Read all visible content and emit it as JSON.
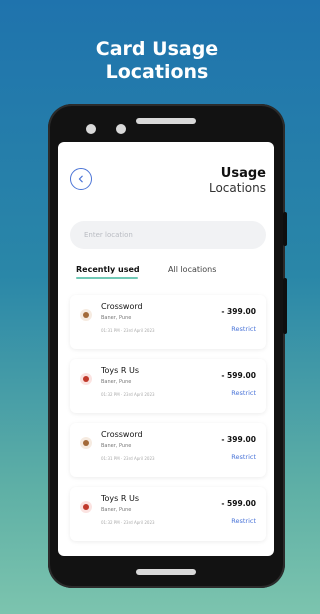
{
  "headline": {
    "line1": "Card Usage",
    "line2": "Locations"
  },
  "header": {
    "title": "Usage",
    "subtitle": "Locations"
  },
  "search": {
    "placeholder": "Enter location",
    "value": ""
  },
  "tabs": [
    {
      "label": "Recently used"
    },
    {
      "label": "All locations"
    }
  ],
  "transactions": [
    {
      "store": "Crossword",
      "location": "Baner, Pune",
      "datetime": "01:31 PM · 23rd April 2023",
      "amount": "- 399.00",
      "action": "Restrict",
      "icon": "bookstore-icon",
      "icon_color": "#a36a3a",
      "icon_bg": "#f6ebe1"
    },
    {
      "store": "Toys R Us",
      "location": "Baner, Pune",
      "datetime": "01:32 PM · 23rd April 2023",
      "amount": "- 599.00",
      "action": "Restrict",
      "icon": "toy-store-icon",
      "icon_color": "#c0392b",
      "icon_bg": "#fbe3e1"
    },
    {
      "store": "Crossword",
      "location": "Baner, Pune",
      "datetime": "01:31 PM · 23rd April 2023",
      "amount": "- 399.00",
      "action": "Restrict",
      "icon": "bookstore-icon",
      "icon_color": "#a36a3a",
      "icon_bg": "#f6ebe1"
    },
    {
      "store": "Toys R Us",
      "location": "Baner, Pune",
      "datetime": "01:32 PM · 23rd April 2023",
      "amount": "- 599.00",
      "action": "Restrict",
      "icon": "toy-store-icon",
      "icon_color": "#c0392b",
      "icon_bg": "#fbe3e1"
    }
  ],
  "colors": {
    "accent": "#4a74d8",
    "tab_underline": "#6fc8b5",
    "background_top": "#1f73ad",
    "background_bottom": "#7cc4ae"
  }
}
